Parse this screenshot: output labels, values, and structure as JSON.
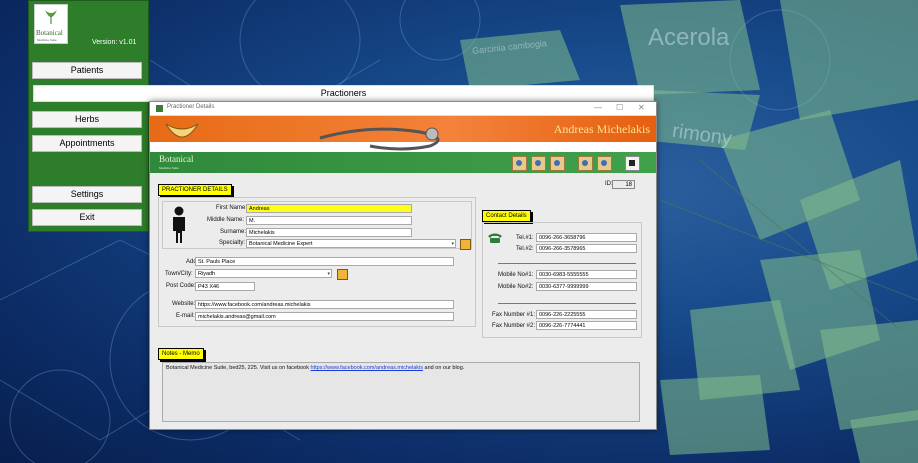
{
  "app": {
    "logo_line1": "Botanical",
    "logo_line2": "Medicine Suite",
    "version": "Version: v1.01"
  },
  "menu": [
    {
      "label": "Patients"
    },
    {
      "label": "Practioners"
    },
    {
      "label": "Herbs"
    },
    {
      "label": "Appointments"
    },
    {
      "label": "Settings"
    },
    {
      "label": "Exit"
    }
  ],
  "background_words": {
    "acerola": "Acerola",
    "garcinia": "Garcinia cambogia",
    "rimony": "rimony"
  },
  "window": {
    "title": "Practioner Details",
    "controls": {
      "minimize": "—",
      "maximize": "☐",
      "close": "✕"
    },
    "banner_name": "Andreas Michelakis",
    "banner_brand": "Botanical",
    "banner_brand2": "Medicine Suite"
  },
  "practioner": {
    "section_title": "PRACTIONER DETAILS",
    "id_label": "ID:",
    "id_value": "18",
    "first_name_label": "First Name:",
    "first_name": "Andreas",
    "middle_name_label": "Middle Name:",
    "middle_name": "M.",
    "surname_label": "Surname:",
    "surname": "Michelakis",
    "specialty_label": "Specialty:",
    "specialty": "Botanical Medicine Expert",
    "address_label": "Address:",
    "address": "St. Pauls Place",
    "town_label": "Town/City:",
    "town": "Riyadh",
    "postcode_label": "Post Code:",
    "postcode": "P43 X46",
    "website_label": "Website:",
    "website": "https://www.facebook.com/andreas.michelakis",
    "email_label": "E-mail:",
    "email": "michelakis.andreas@gmail.com"
  },
  "contact": {
    "section_title": "Contact Details",
    "tel1_label": "Tel.#1:",
    "tel1": "0096-266-3658796",
    "tel2_label": "Tel.#2:",
    "tel2": "0096-266-3578965",
    "mobile1_label": "Mobile No#1:",
    "mobile1": "0030-6983-5555555",
    "mobile2_label": "Mobile No#2:",
    "mobile2": "0030-6377-9999999",
    "fax1_label": "Fax Number #1:",
    "fax1": "0096-226-2225555",
    "fax2_label": "Fax Number #2:",
    "fax2": "0096-226-7774441"
  },
  "notes": {
    "section_title": "Notes - Memo",
    "text_before": "Botanical Medicine Suite, bed25, 225. Visit us on facebook ",
    "link": "https://www.facebook.com/andreas.michelakis",
    "text_after": " and on our blog."
  }
}
